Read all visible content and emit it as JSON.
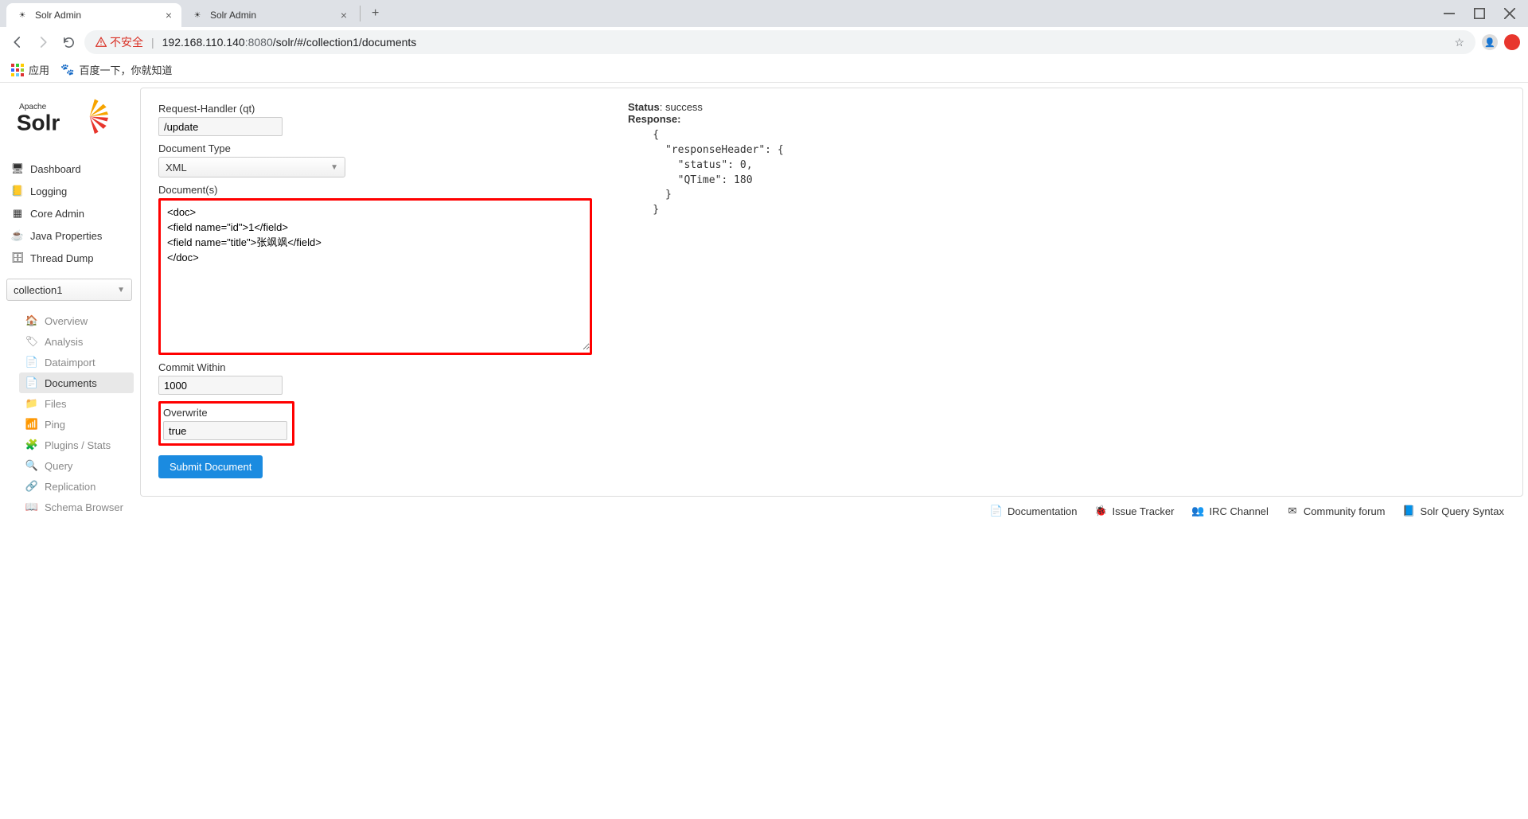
{
  "browser": {
    "tabs": [
      {
        "title": "Solr Admin",
        "active": true
      },
      {
        "title": "Solr Admin",
        "active": false
      }
    ],
    "insecure_label": "不安全",
    "url_host": "192.168.110.140",
    "url_port": ":8080",
    "url_path": "/solr/#/collection1/documents",
    "apps_label": "应用",
    "bookmarks": [
      {
        "label": "百度一下，你就知道"
      }
    ]
  },
  "logo": {
    "prefix": "Apache",
    "name": "Solr"
  },
  "nav": {
    "items": [
      {
        "label": "Dashboard",
        "icon": "dashboard-icon",
        "glyph": "🖥"
      },
      {
        "label": "Logging",
        "icon": "logging-icon",
        "glyph": "📒"
      },
      {
        "label": "Core Admin",
        "icon": "core-admin-icon",
        "glyph": "▦"
      },
      {
        "label": "Java Properties",
        "icon": "java-properties-icon",
        "glyph": "☕"
      },
      {
        "label": "Thread Dump",
        "icon": "thread-dump-icon",
        "glyph": "🗄"
      }
    ]
  },
  "core_selector": {
    "value": "collection1"
  },
  "subnav": {
    "items": [
      {
        "label": "Overview",
        "icon": "overview-icon",
        "glyph": "🏠",
        "active": false
      },
      {
        "label": "Analysis",
        "icon": "analysis-icon",
        "glyph": "🏷",
        "active": false
      },
      {
        "label": "Dataimport",
        "icon": "dataimport-icon",
        "glyph": "📄",
        "active": false
      },
      {
        "label": "Documents",
        "icon": "documents-icon",
        "glyph": "📄",
        "active": true
      },
      {
        "label": "Files",
        "icon": "files-icon",
        "glyph": "📁",
        "active": false
      },
      {
        "label": "Ping",
        "icon": "ping-icon",
        "glyph": "📶",
        "active": false
      },
      {
        "label": "Plugins / Stats",
        "icon": "plugins-icon",
        "glyph": "🧩",
        "active": false
      },
      {
        "label": "Query",
        "icon": "query-icon",
        "glyph": "🔍",
        "active": false
      },
      {
        "label": "Replication",
        "icon": "replication-icon",
        "glyph": "🔗",
        "active": false
      },
      {
        "label": "Schema Browser",
        "icon": "schema-icon",
        "glyph": "📖",
        "active": false
      }
    ]
  },
  "form": {
    "request_handler_label": "Request-Handler (qt)",
    "request_handler_value": "/update",
    "doc_type_label": "Document Type",
    "doc_type_value": "XML",
    "documents_label": "Document(s)",
    "documents_value": "<doc>\n<field name=\"id\">1</field>\n<field name=\"title\">张飒飒</field>\n</doc>",
    "commit_within_label": "Commit Within",
    "commit_within_value": "1000",
    "overwrite_label": "Overwrite",
    "overwrite_value": "true",
    "submit_label": "Submit Document"
  },
  "response": {
    "status_label": "Status",
    "status_value": "success",
    "response_label": "Response:",
    "body": "    {\n      \"responseHeader\": {\n        \"status\": 0,\n        \"QTime\": 180\n      }\n    }"
  },
  "footer": {
    "links": [
      {
        "label": "Documentation",
        "icon": "doc-icon",
        "glyph": "📄"
      },
      {
        "label": "Issue Tracker",
        "icon": "bug-icon",
        "glyph": "🐞"
      },
      {
        "label": "IRC Channel",
        "icon": "irc-icon",
        "glyph": "👥"
      },
      {
        "label": "Community forum",
        "icon": "mail-icon",
        "glyph": "✉"
      },
      {
        "label": "Solr Query Syntax",
        "icon": "syntax-icon",
        "glyph": "📘"
      }
    ]
  }
}
